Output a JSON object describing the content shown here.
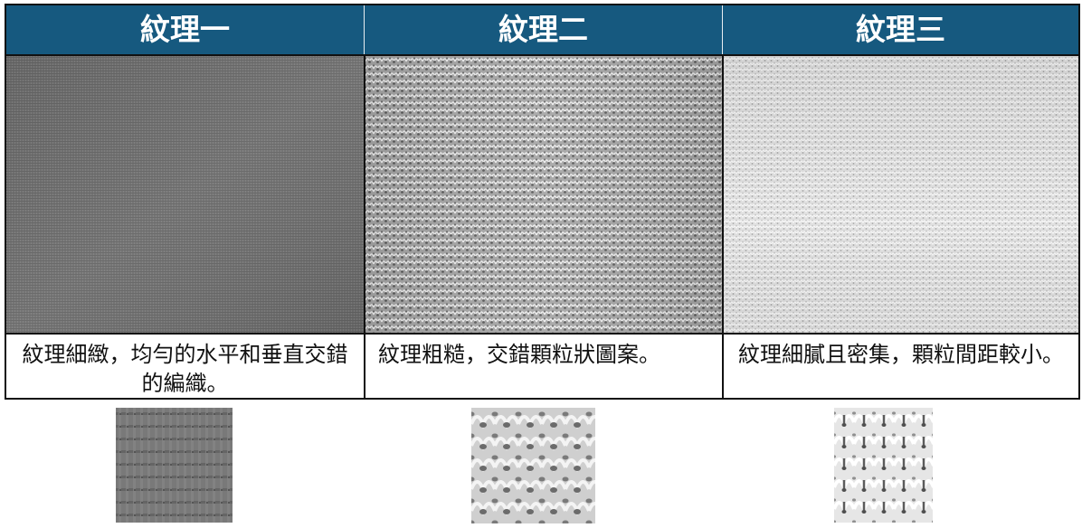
{
  "columns": [
    {
      "title": "紋理一",
      "description": "紋理細緻，均勻的水平和垂直交錯的編織。",
      "swatch_icon": "fine-weave-texture",
      "tone": "#707070"
    },
    {
      "title": "紋理二",
      "description": "紋理粗糙，交錯顆粒狀圖案。",
      "swatch_icon": "coarse-knit-texture",
      "tone": "#9a9a9a"
    },
    {
      "title": "紋理三",
      "description": "紋理細膩且密集，顆粒間距較小。",
      "swatch_icon": "dense-knit-texture",
      "tone": "#dcdcdc"
    }
  ],
  "colors": {
    "header_background": "#16597f",
    "header_text": "#ffffff",
    "border": "#111111"
  }
}
